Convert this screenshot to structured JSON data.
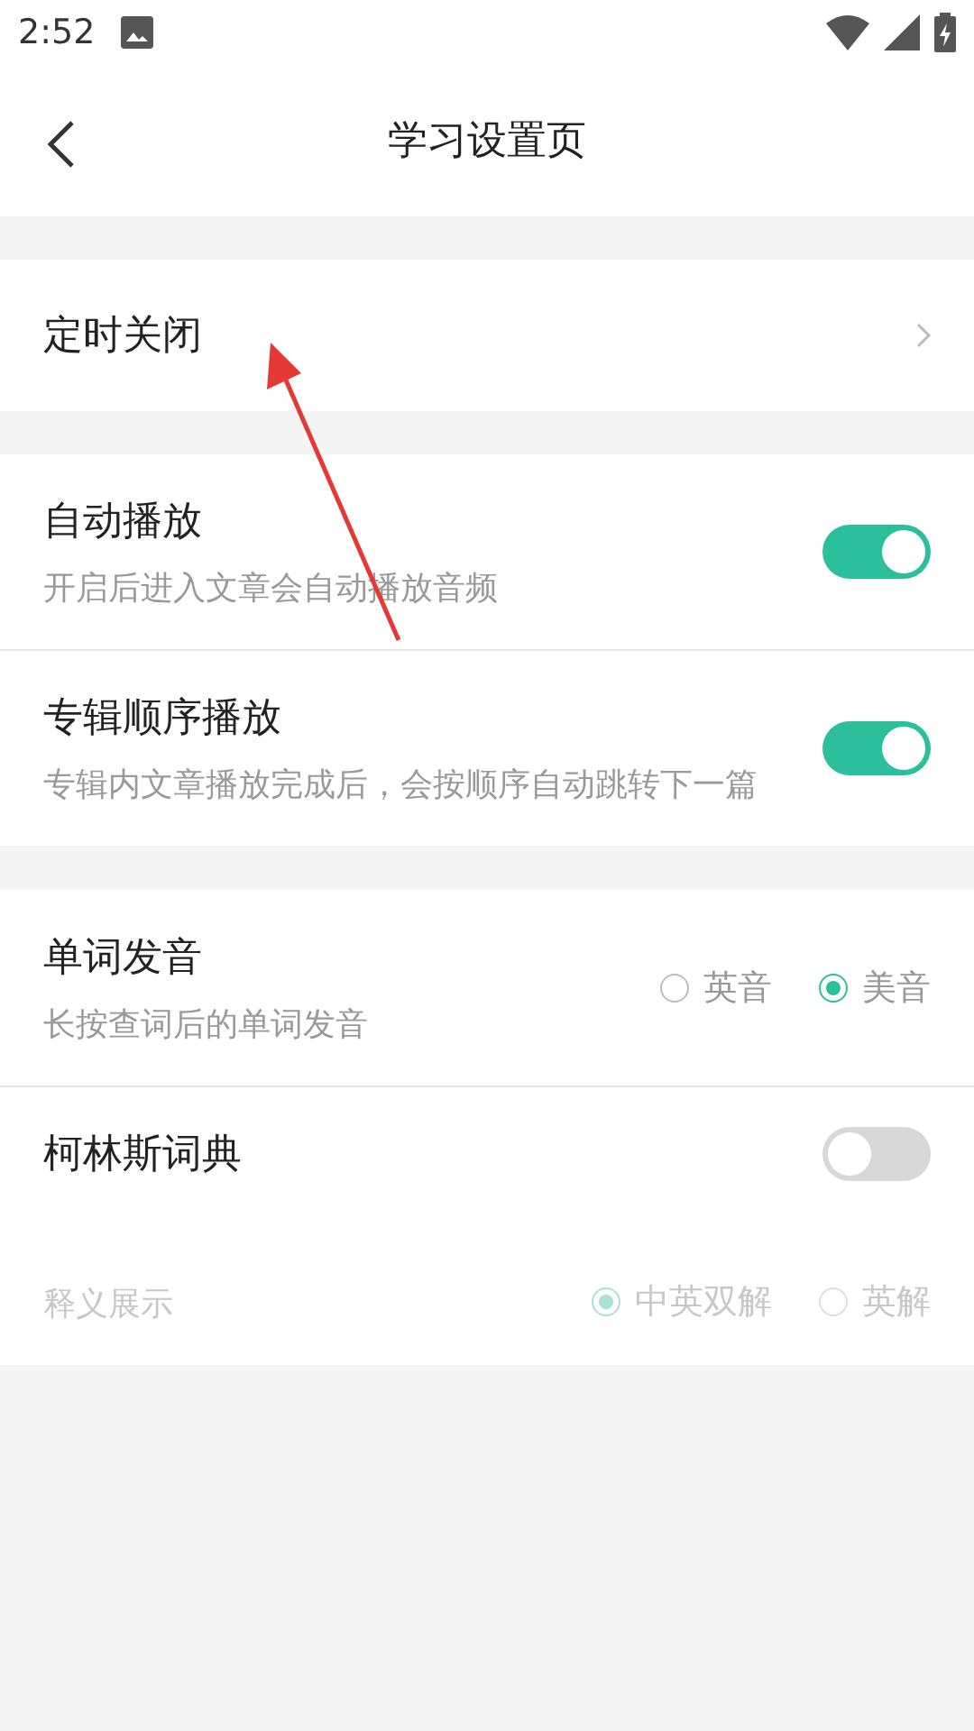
{
  "status_bar": {
    "time": "2:52"
  },
  "header": {
    "title": "学习设置页"
  },
  "sections": [
    {
      "rows": [
        {
          "kind": "link",
          "title": "定时关闭"
        }
      ]
    },
    {
      "rows": [
        {
          "kind": "toggle",
          "title": "自动播放",
          "subtitle": "开启后进入文章会自动播放音频",
          "on": true
        },
        {
          "kind": "toggle",
          "title": "专辑顺序播放",
          "subtitle": "专辑内文章播放完成后，会按顺序自动跳转下一篇",
          "on": true
        }
      ]
    },
    {
      "rows": [
        {
          "kind": "radio",
          "title": "单词发音",
          "subtitle": "长按查词后的单词发音",
          "disabled": false,
          "options": [
            {
              "label": "英音",
              "selected": false
            },
            {
              "label": "美音",
              "selected": true
            }
          ]
        },
        {
          "kind": "dictionary",
          "title": "柯林斯词典",
          "on": false,
          "subtitle": "释义展示",
          "disabled": true,
          "options": [
            {
              "label": "中英双解",
              "selected": true
            },
            {
              "label": "英解",
              "selected": false
            }
          ]
        }
      ]
    }
  ]
}
